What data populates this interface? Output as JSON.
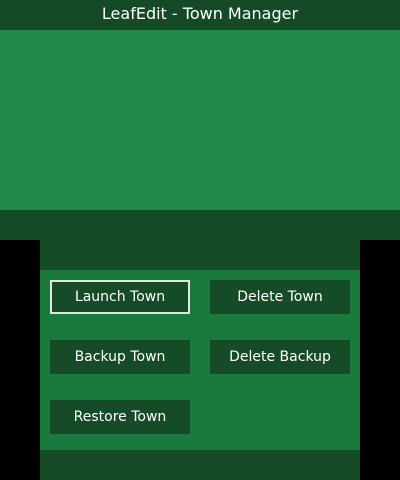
{
  "header": {
    "title": "LeafEdit - Town Manager"
  },
  "menu": {
    "launch_town": "Launch Town",
    "delete_town": "Delete Town",
    "backup_town": "Backup Town",
    "delete_backup": "Delete Backup",
    "restore_town": "Restore Town",
    "selected": "launch_town"
  },
  "colors": {
    "top_screen_bg": "#1f8a47",
    "bottom_screen_bg": "#1a7a3d",
    "bar_bg": "#144a25",
    "button_bg": "#164b28",
    "selection_border": "#dfe7de"
  }
}
